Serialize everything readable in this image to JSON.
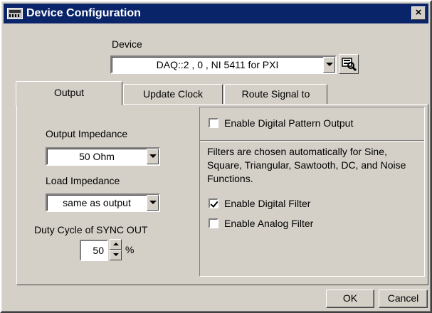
{
  "window": {
    "title": "Device Configuration",
    "close_glyph": "×"
  },
  "device": {
    "label": "Device",
    "value": "DAQ::2 , 0 , NI 5411 for PXI",
    "browse_icon": "device-search-icon"
  },
  "tabs": [
    {
      "label": "Output",
      "selected": true
    },
    {
      "label": "Update Clock",
      "selected": false
    },
    {
      "label": "Route Signal to",
      "selected": false
    }
  ],
  "output": {
    "output_impedance_label": "Output Impedance",
    "output_impedance_value": "50 Ohm",
    "load_impedance_label": "Load Impedance",
    "load_impedance_value": "same as output",
    "duty_cycle_label": "Duty Cycle of SYNC OUT",
    "duty_cycle_value": "50",
    "duty_cycle_unit": "%"
  },
  "filters": {
    "digital_pattern_label": "Enable Digital Pattern Output",
    "digital_pattern_checked": false,
    "info_text": "Filters are chosen automatically for Sine, Square, Triangular, Sawtooth, DC, and Noise Functions.",
    "digital_filter_label": "Enable Digital Filter",
    "digital_filter_checked": true,
    "analog_filter_label": "Enable Analog Filter",
    "analog_filter_checked": false
  },
  "buttons": {
    "ok": "OK",
    "cancel": "Cancel"
  },
  "colors": {
    "title_bar": "#0a246a",
    "dialog_face": "#d4d0c8"
  }
}
